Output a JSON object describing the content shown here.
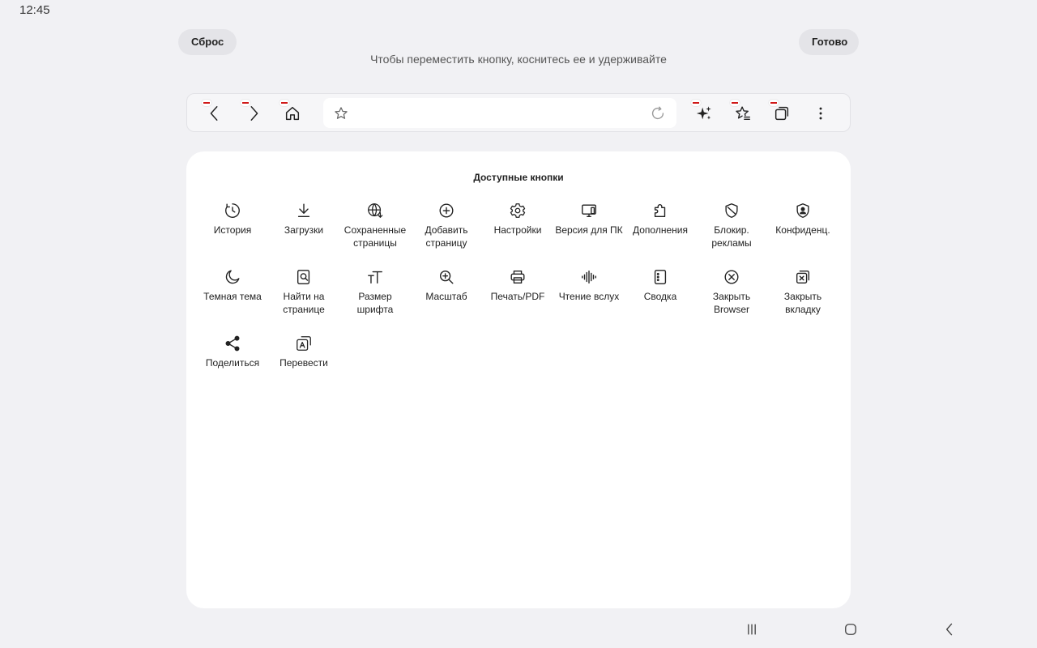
{
  "status": {
    "time": "12:45"
  },
  "header": {
    "reset_label": "Сброс",
    "done_label": "Готово",
    "hint": "Чтобы переместить кнопку, коснитесь ее и удерживайте"
  },
  "toolbar": {
    "left_buttons": [
      "back-icon",
      "forward-icon",
      "home-icon"
    ],
    "right_buttons": [
      "sparkle-icon",
      "bookmarks-icon",
      "tabs-icon",
      "more-icon"
    ],
    "url_bar": {
      "left_icon": "star-icon",
      "right_icon": "reload-icon"
    }
  },
  "panel": {
    "title": "Доступные кнопки",
    "items": [
      {
        "label": "История",
        "icon": "history-icon"
      },
      {
        "label": "Загрузки",
        "icon": "download-icon"
      },
      {
        "label": "Сохраненные страницы",
        "icon": "saved-pages-icon"
      },
      {
        "label": "Добавить страницу",
        "icon": "add-page-icon"
      },
      {
        "label": "Настройки",
        "icon": "settings-icon"
      },
      {
        "label": "Версия для ПК",
        "icon": "desktop-version-icon"
      },
      {
        "label": "Дополнения",
        "icon": "addons-icon"
      },
      {
        "label": "Блокир. рекламы",
        "icon": "ad-block-icon"
      },
      {
        "label": "Конфиденц.",
        "icon": "privacy-icon"
      },
      {
        "label": "Темная тема",
        "icon": "dark-mode-icon"
      },
      {
        "label": "Найти на странице",
        "icon": "find-on-page-icon"
      },
      {
        "label": "Размер шрифта",
        "icon": "font-size-icon"
      },
      {
        "label": "Масштаб",
        "icon": "zoom-icon"
      },
      {
        "label": "Печать/PDF",
        "icon": "print-icon"
      },
      {
        "label": "Чтение вслух",
        "icon": "read-aloud-icon"
      },
      {
        "label": "Сводка",
        "icon": "summary-icon"
      },
      {
        "label": "Закрыть Browser",
        "icon": "close-browser-icon"
      },
      {
        "label": "Закрыть вкладку",
        "icon": "close-tab-icon"
      },
      {
        "label": "Поделиться",
        "icon": "share-icon"
      },
      {
        "label": "Перевести",
        "icon": "translate-icon"
      }
    ]
  },
  "navbar": {
    "buttons": [
      "recent-apps-icon",
      "home-nav-icon",
      "back-nav-icon"
    ]
  }
}
